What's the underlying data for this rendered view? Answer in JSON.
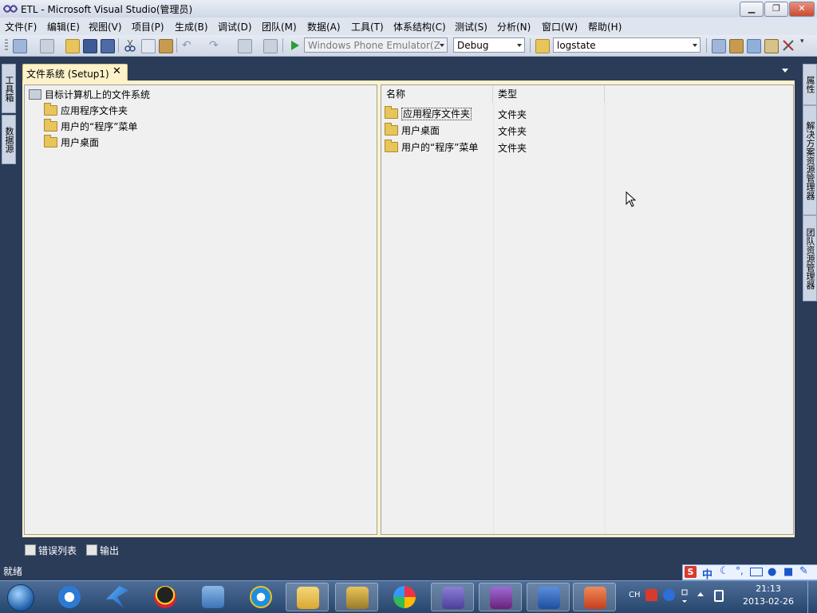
{
  "window": {
    "title": "ETL - Microsoft Visual Studio(管理员)"
  },
  "menu": [
    "文件(F)",
    "编辑(E)",
    "视图(V)",
    "项目(P)",
    "生成(B)",
    "调试(D)",
    "团队(M)",
    "数据(A)",
    "工具(T)",
    "体系结构(C)",
    "测试(S)",
    "分析(N)",
    "窗口(W)",
    "帮助(H)"
  ],
  "toolbar": {
    "device": "Windows Phone Emulator(Z",
    "config": "Debug",
    "find": "logstate"
  },
  "sidebar_left": [
    "工具箱",
    "数据源"
  ],
  "sidebar_right": [
    "属性",
    "解决方案资源管理器",
    "团队资源管理器"
  ],
  "document": {
    "tab": "文件系统 (Setup1)",
    "close": "✕"
  },
  "tree": {
    "root": "目标计算机上的文件系统",
    "children": [
      "应用程序文件夹",
      "用户的“程序”菜单",
      "用户桌面"
    ]
  },
  "list": {
    "columns": [
      "名称",
      "类型"
    ],
    "rows": [
      {
        "name": "应用程序文件夹",
        "type": "文件夹"
      },
      {
        "name": "用户桌面",
        "type": "文件夹"
      },
      {
        "name": "用户的“程序”菜单",
        "type": "文件夹"
      }
    ]
  },
  "bottom_tabs": [
    "错误列表",
    "输出"
  ],
  "status": "就绪",
  "ime": "中",
  "tray": {
    "lang": "CH",
    "time": "21:13",
    "date": "2013-02-26"
  },
  "colors": {
    "accent": "#2b3c59",
    "doc_tab": "#fdf2c9",
    "folder": "#e8c55a"
  }
}
